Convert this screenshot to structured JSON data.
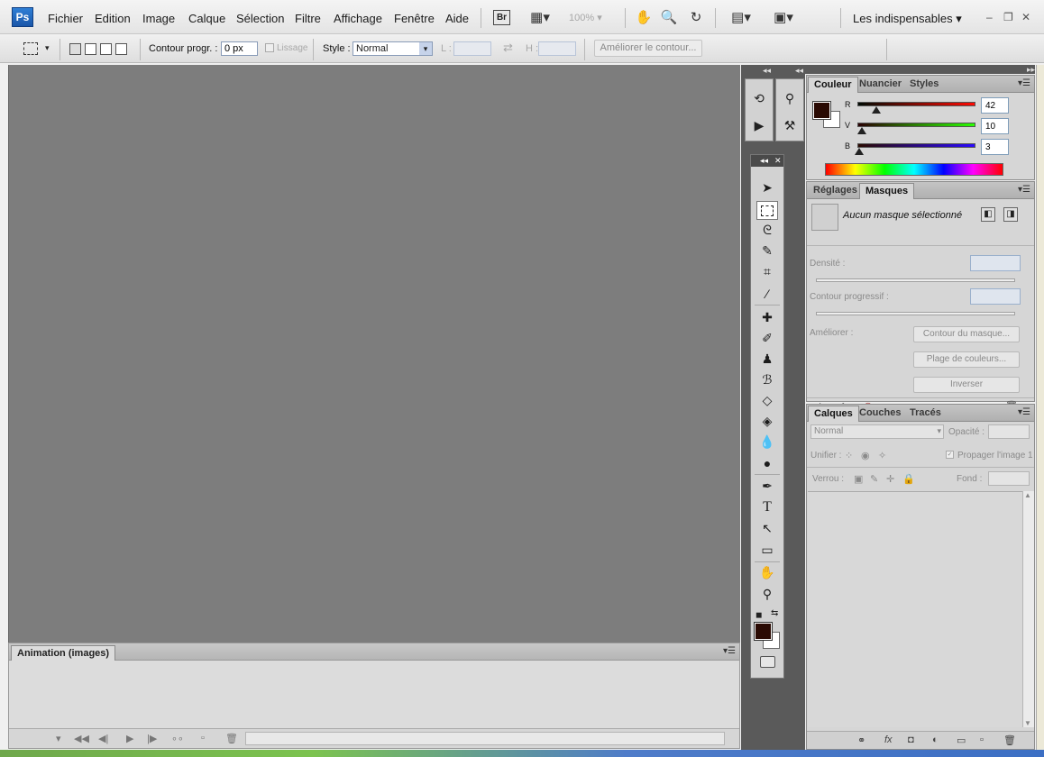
{
  "app": {
    "logo": "Ps",
    "menu": [
      "Fichier",
      "Edition",
      "Image",
      "Calque",
      "Sélection",
      "Filtre",
      "Affichage",
      "Fenêtre",
      "Aide"
    ],
    "bridge_label": "Br",
    "zoom": "100%",
    "workspace": "Les indispensables",
    "window_controls": [
      "–",
      "❐",
      "✕"
    ]
  },
  "options": {
    "feather_label": "Contour progr. :",
    "feather_value": "0 px",
    "antialias_label": "Lissage",
    "style_label": "Style :",
    "style_value": "Normal",
    "width_label": "L :",
    "height_label": "H :",
    "refine_button": "Améliorer le contour..."
  },
  "animation_panel": {
    "tab": "Animation (images)"
  },
  "color_panel": {
    "tabs": [
      "Couleur",
      "Nuancier",
      "Styles"
    ],
    "r_label": "R",
    "g_label": "V",
    "b_label": "B",
    "r_value": "42",
    "g_value": "10",
    "b_value": "3",
    "foreground_hex": "#2a0a03",
    "background_hex": "#ffffff"
  },
  "masks_panel": {
    "tabs": [
      "Réglages",
      "Masques"
    ],
    "no_mask": "Aucun masque sélectionné",
    "density_label": "Densité :",
    "feather_label": "Contour progressif :",
    "refine_label": "Améliorer :",
    "mask_edge_button": "Contour du masque...",
    "color_range_button": "Plage de couleurs...",
    "invert_button": "Inverser"
  },
  "layers_panel": {
    "tabs": [
      "Calques",
      "Couches",
      "Tracés"
    ],
    "blend_mode": "Normal",
    "opacity_label": "Opacité :",
    "unify_label": "Unifier :",
    "propagate_label": "Propager l'image 1",
    "lock_label": "Verrou :",
    "fill_label": "Fond :"
  },
  "toolbox": {
    "tools": [
      "move-tool",
      "rectangular-marquee-tool",
      "lasso-tool",
      "quick-selection-tool",
      "crop-tool",
      "eyedropper-tool",
      "spot-healing-tool",
      "brush-tool",
      "clone-stamp-tool",
      "history-brush-tool",
      "eraser-tool",
      "paint-bucket-tool",
      "blur-tool",
      "dodge-tool",
      "pen-tool",
      "type-tool",
      "path-selection-tool",
      "shape-tool",
      "hand-tool",
      "zoom-tool"
    ],
    "type_glyph": "T"
  }
}
